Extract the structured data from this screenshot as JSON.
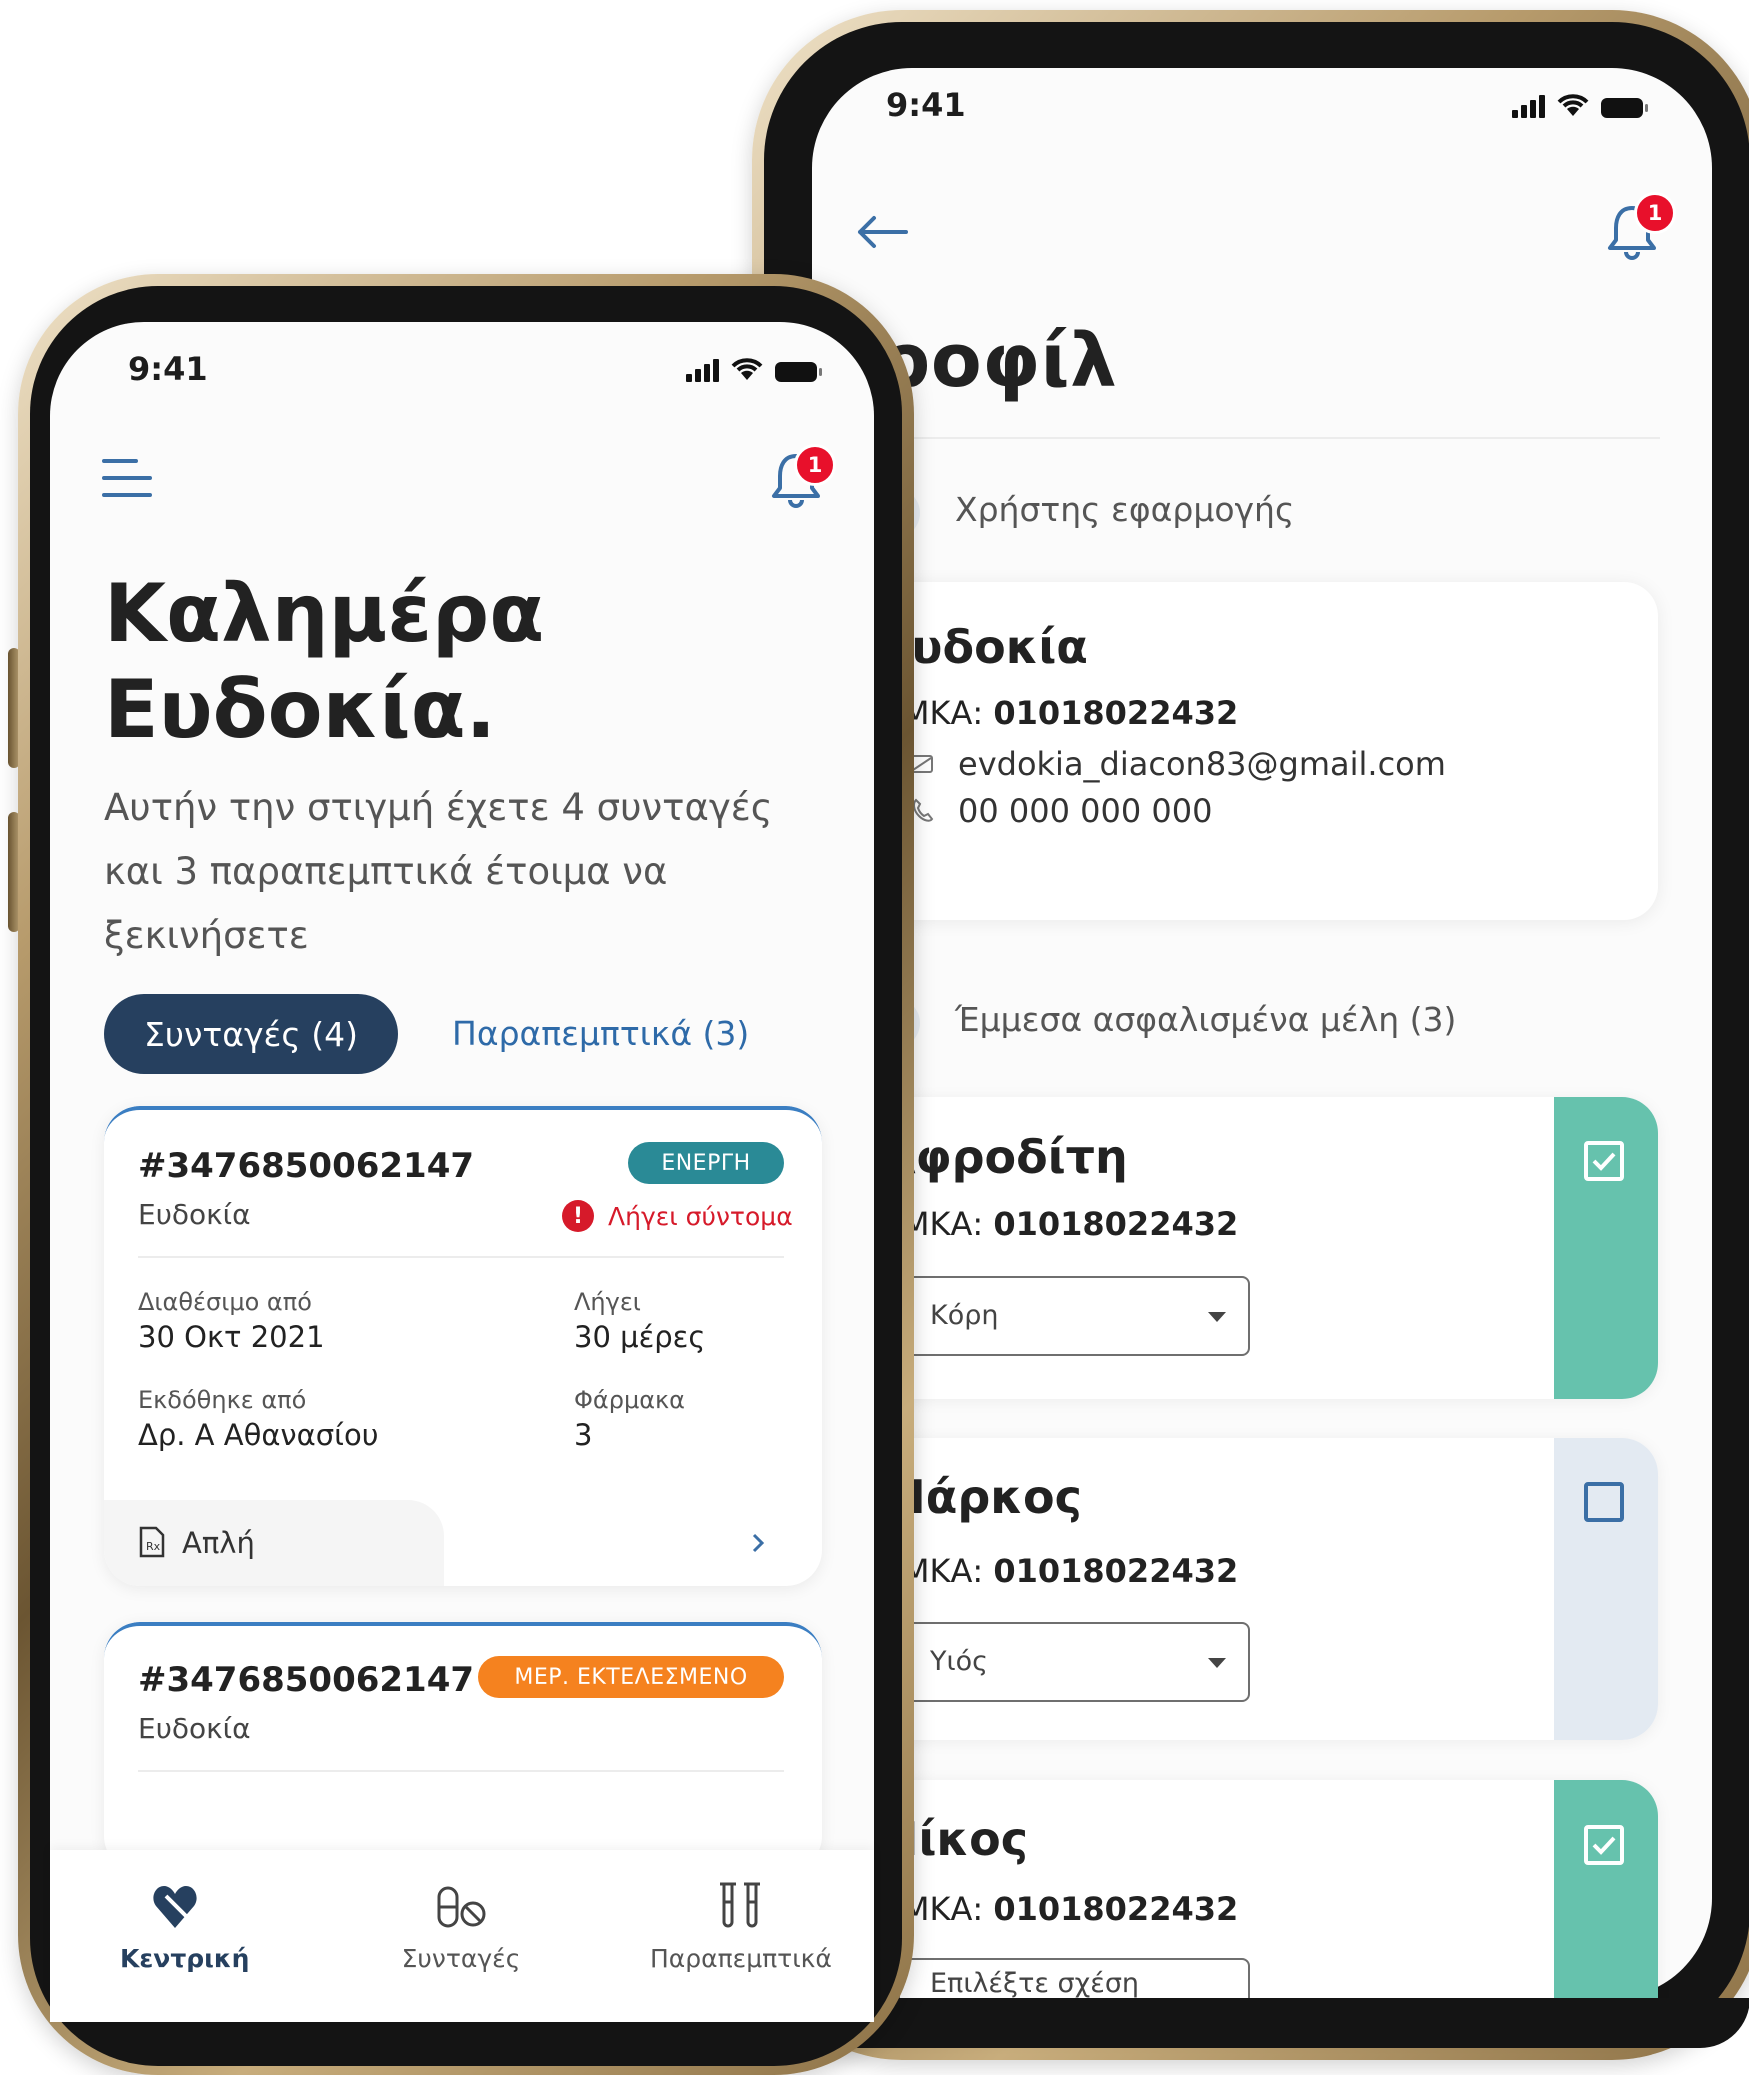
{
  "status_bar": {
    "time": "9:41"
  },
  "profile_screen": {
    "notifications_count": "1",
    "title": "Προφίλ",
    "user_section_label": "Χρήστης εφαρμογής",
    "user": {
      "name": "Ευδοκία",
      "amka_label": "ΑΜΚΑ:",
      "amka_value": "01018022432",
      "email": "evdokia_diacon83@gmail.com",
      "phone": "00 000 000 000"
    },
    "members_section_label": "Έμμεσα ασφαλισμένα μέλη (3)",
    "members": [
      {
        "name": "Αφροδίτη",
        "amka_label": "ΑΜΚΑ:",
        "amka_value": "01018022432",
        "relation": "Κόρη",
        "checked": true
      },
      {
        "name": "Μάρκος",
        "amka_label": "ΑΜΚΑ:",
        "amka_value": "01018022432",
        "relation": "Υιός",
        "checked": false
      },
      {
        "name": "Νίκος",
        "amka_label": "ΑΜΚΑ:",
        "amka_value": "01018022432",
        "relation": "Επιλέξτε σχέση",
        "checked": true
      }
    ],
    "colors": {
      "checked": "#66c2ad",
      "unchecked": "#e3eaf2"
    }
  },
  "home_screen": {
    "notifications_count": "1",
    "greeting_line1": "Καλημέρα",
    "greeting_line2": "Ευδοκία.",
    "subtitle_line1": "Αυτήν την στιγμή έχετε 4 συνταγές",
    "subtitle_line2": "και 3 παραπεμπτικά έτοιμα  να",
    "subtitle_line3": "ξεκινήσετε",
    "tabs": [
      {
        "label": "Συνταγές (4)",
        "active": true
      },
      {
        "label": "Παραπεμπτικά (3)",
        "active": false
      }
    ],
    "prescriptions": [
      {
        "id": "#3476850062147",
        "patient": "Ευδοκία",
        "status": "ΕΝΕΡΓΗ",
        "status_color": "#2a8a96",
        "warning": "Λήγει σύντομα",
        "available_from_label": "Διαθέσιμο από",
        "available_from": "30 Οκτ 2021",
        "expires_label": "Λήγει",
        "expires": "30 μέρες",
        "issued_by_label": "Εκδόθηκε από",
        "issued_by": "Δρ. Α Αθανασίου",
        "drugs_label": "Φάρμακα",
        "drugs": "3",
        "type": "Απλή"
      },
      {
        "id": "#3476850062147",
        "patient": "Ευδοκία",
        "status": "ΜΕΡ. ΕΚΤΕΛΕΣΜΕΝΟ",
        "status_color": "#f5821f"
      }
    ],
    "bottom_nav": [
      {
        "label": "Κεντρική",
        "icon": "heart-home-icon",
        "active": true
      },
      {
        "label": "Συνταγές",
        "icon": "pills-icon",
        "active": false
      },
      {
        "label": "Παραπεμπτικά",
        "icon": "test-tubes-icon",
        "active": false
      }
    ]
  }
}
